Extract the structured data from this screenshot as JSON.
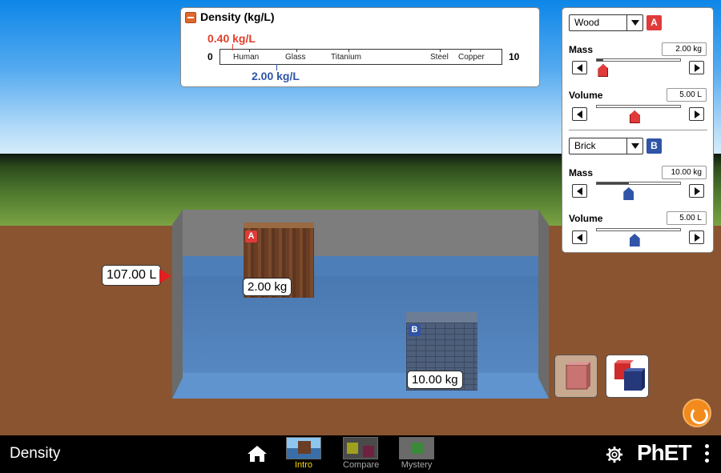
{
  "density_panel": {
    "title": "Density (kg/L)",
    "red_value": "0.40 kg/L",
    "blue_value": "2.00 kg/L",
    "min_label": "0",
    "max_label": "10",
    "materials": [
      "Human",
      "Glass",
      "Titanium",
      "Steel",
      "Copper"
    ]
  },
  "pool": {
    "volume_readout": "107.00 L"
  },
  "blocks": {
    "a": {
      "tag": "A",
      "mass_label": "2.00 kg"
    },
    "b": {
      "tag": "B",
      "mass_label": "10.00 kg"
    }
  },
  "controls": {
    "block_a": {
      "material": "Wood",
      "tag": "A",
      "mass_label": "Mass",
      "mass_value": "2.00 kg",
      "volume_label": "Volume",
      "volume_value": "5.00 L",
      "mass_fraction": 0.08,
      "volume_fraction": 0.45
    },
    "block_b": {
      "material": "Brick",
      "tag": "B",
      "mass_label": "Mass",
      "mass_value": "10.00 kg",
      "volume_label": "Volume",
      "volume_value": "5.00 L",
      "mass_fraction": 0.38,
      "volume_fraction": 0.45
    }
  },
  "colors": {
    "accent_red": "#e03a3a",
    "accent_blue": "#2f54a8",
    "active_tab": "#ffd800"
  },
  "navbar": {
    "app_title": "Density",
    "tabs": [
      {
        "label": "Intro",
        "active": true
      },
      {
        "label": "Compare",
        "active": false
      },
      {
        "label": "Mystery",
        "active": false
      }
    ],
    "icons": [
      "home-icon",
      "gear-icon",
      "phet-logo",
      "kebab-menu-icon"
    ]
  },
  "logo_text": "PhET"
}
